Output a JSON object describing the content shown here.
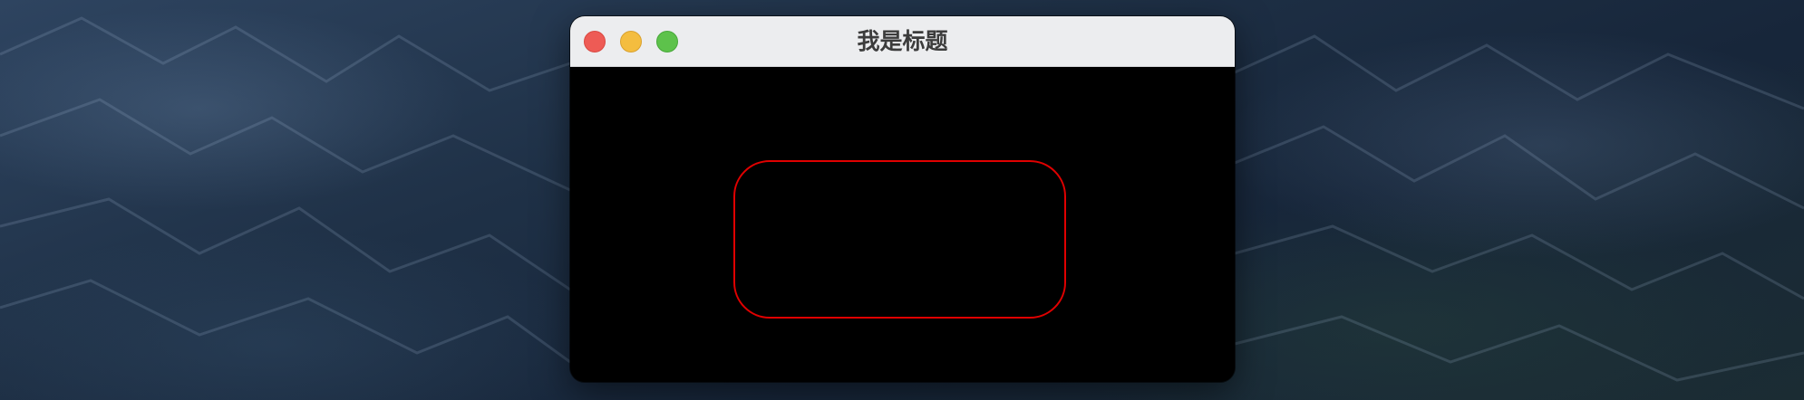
{
  "window": {
    "title": "我是标题",
    "controls": {
      "close": "close-button",
      "minimize": "minimize-button",
      "zoom": "zoom-button"
    }
  },
  "colors": {
    "titlebar": "#ecedef",
    "canvas_background": "#000000",
    "shape_stroke": "#e00000",
    "close": "#ee5b55",
    "minimize": "#f4bd3f",
    "zoom": "#5dc24b"
  },
  "canvas": {
    "shape": "rounded-rectangle outline"
  }
}
